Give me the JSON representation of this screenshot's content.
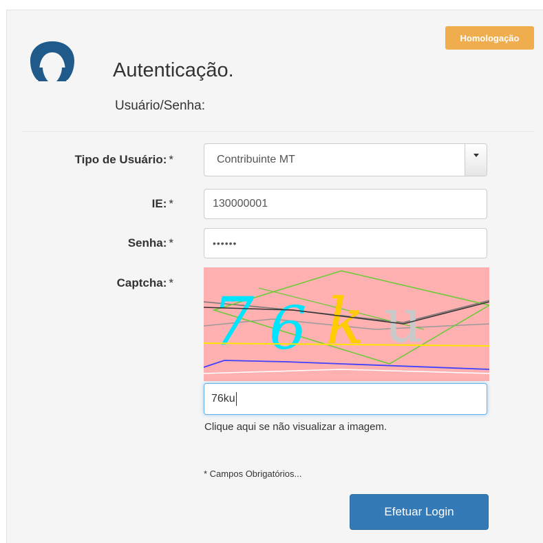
{
  "environment_badge": "Homologação",
  "header": {
    "title": "Autenticação.",
    "subtitle": "Usuário/Senha:"
  },
  "form": {
    "user_type": {
      "label": "Tipo de Usuário:",
      "required_mark": "*",
      "selected": "Contribuinte MT"
    },
    "ie": {
      "label": "IE:",
      "required_mark": "*",
      "value": "130000001"
    },
    "password": {
      "label": "Senha:",
      "required_mark": "*",
      "masked_value": "••••••"
    },
    "captcha": {
      "label": "Captcha:",
      "required_mark": "*",
      "image_text": "76ku",
      "value": "76ku",
      "reload_hint": "Clique aqui se não visualizar a imagem."
    },
    "required_note": "* Campos Obrigatórios...",
    "submit_label": "Efetuar Login"
  },
  "colors": {
    "badge": "#f0ad4e",
    "primary_button": "#337ab7",
    "avatar": "#1f5a8a",
    "captcha_background": "#ffb0b0",
    "focus_border": "#66afe9"
  }
}
